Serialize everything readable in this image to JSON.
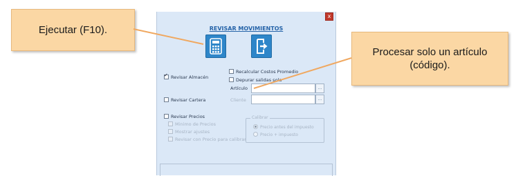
{
  "dialog": {
    "close_label": "x",
    "title": "REVISAR MOVIMIENTOS",
    "buttons": {
      "execute_icon": "calculator-icon",
      "exit_icon": "exit-arrow-icon"
    },
    "checks": {
      "revisar_almacen": "Revisar Almacén",
      "recalcular_costos": "Recalcular Costos Promedio",
      "depurar_salidas": "Depurar salidas sola",
      "revisar_cartera": "Revisar Cartera",
      "revisar_precios": "Revisar Precios",
      "sub1": "Minimo de Precios",
      "sub2": "Mostrar ajustes",
      "sub3": "Revisar con Precio para calibrar"
    },
    "labels": {
      "articulo": "Artículo",
      "cliente": "Cliente"
    },
    "field_buttons": {
      "articulo_btn": "...",
      "cliente_btn": "..."
    },
    "group": {
      "legend": "Calibrar",
      "radio1": "Precio antes del impuesto",
      "radio2": "Precio + impuesto"
    }
  },
  "callouts": {
    "execute": "Ejecutar (F10).",
    "process_single": "Procesar solo un artículo (código)."
  },
  "colors": {
    "callout_fill": "#fbd7a4",
    "dialog_bg": "#dbe8f7",
    "button_blue": "#2e86c9",
    "title_blue": "#2563a8",
    "close_red": "#c0392b"
  }
}
